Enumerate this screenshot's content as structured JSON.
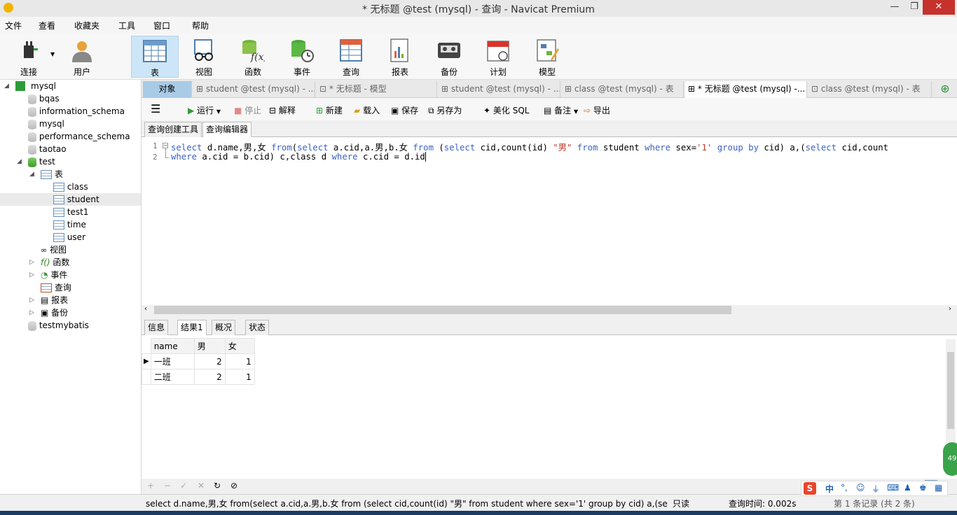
{
  "window": {
    "title": "* 无标题 @test (mysql) - 查询 - Navicat Premium"
  },
  "menu": [
    "文件",
    "查看",
    "收藏夹",
    "工具",
    "窗口",
    "帮助"
  ],
  "toolbar": {
    "connect": "连接",
    "user": "用户",
    "table": "表",
    "view": "视图",
    "function": "函数",
    "event": "事件",
    "query": "查询",
    "report": "报表",
    "backup": "备份",
    "schedule": "计划",
    "model": "模型"
  },
  "nav": {
    "root": "mysql",
    "dbs": [
      "bqas",
      "information_schema",
      "mysql",
      "performance_schema",
      "taotao",
      "test"
    ],
    "tables_group": "表",
    "tables": [
      "class",
      "student",
      "test1",
      "time",
      "user"
    ],
    "groups": [
      "视图",
      "函数",
      "事件",
      "查询",
      "报表",
      "备份"
    ],
    "last_db": "testmybatis"
  },
  "tabs": {
    "objects": "对象",
    "list": [
      "student @test (mysql) - ...",
      "* 无标题 - 模型",
      "student @test (mysql) - ...",
      "class @test (mysql) - 表",
      "* 无标题 @test (mysql) -...",
      "class @test (mysql) - 表"
    ]
  },
  "query_toolbar": {
    "run": "运行",
    "stop": "停止",
    "explain": "解释",
    "new": "新建",
    "load": "载入",
    "save": "保存",
    "save_as": "另存为",
    "beautify": "美化 SQL",
    "comment": "备注",
    "export": "导出"
  },
  "subtabs": [
    "查询创建工具",
    "查询编辑器"
  ],
  "editor": {
    "line_numbers": [
      "1",
      "2"
    ]
  },
  "result_tabs": [
    "信息",
    "结果1",
    "概况",
    "状态"
  ],
  "result": {
    "columns": [
      "name",
      "男",
      "女"
    ],
    "rows": [
      [
        "一班",
        "2",
        "1"
      ],
      [
        "二班",
        "2",
        "1"
      ]
    ]
  },
  "status": {
    "sql": "select d.name,男,女 from(select a.cid,a.男,b.女 from (select cid,count(id) \"男\" from student where sex='1' group by cid) a,(select ci",
    "mode": "只读",
    "time": "查询时间: 0.002s",
    "record": "第 1 条记录 (共 2 条)",
    "ime": "中"
  },
  "colors": {
    "active_tab": "#a9cbe6",
    "keyword": "#3b63c4",
    "string": "#c0392b"
  }
}
